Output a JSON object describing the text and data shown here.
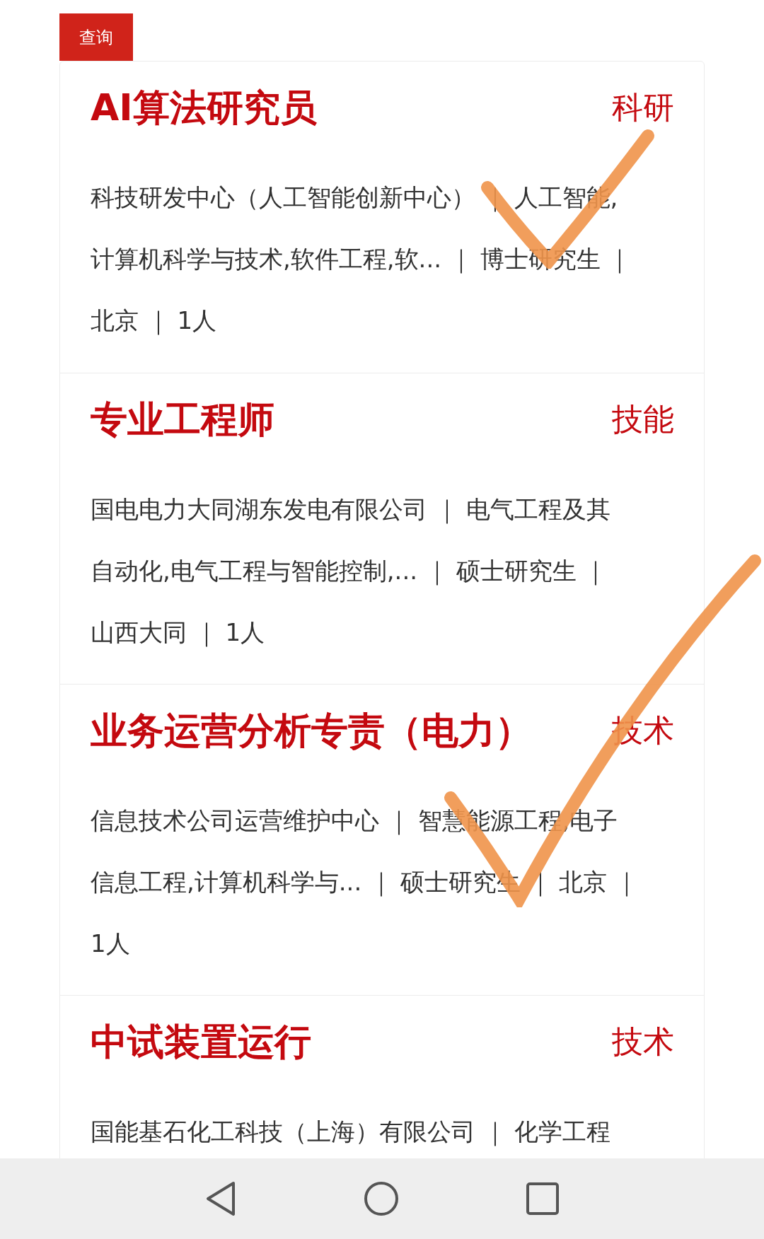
{
  "query_button": "查询",
  "jobs": [
    {
      "title": "AI算法研究员",
      "tag": "科研",
      "info_lines": [
        "科技研发中心（人工智能创新中心） ｜ 人工智能,",
        "计算机科学与技术,软件工程,软... ｜ 博士研究生 ｜",
        "北京 ｜ 1人"
      ]
    },
    {
      "title": "专业工程师",
      "tag": "技能",
      "info_lines": [
        "国电电力大同湖东发电有限公司 ｜ 电气工程及其",
        "自动化,电气工程与智能控制,... ｜ 硕士研究生 ｜",
        "山西大同 ｜ 1人"
      ]
    },
    {
      "title": "业务运营分析专责（电力）",
      "tag": "技术",
      "info_lines": [
        "信息技术公司运营维护中心 ｜ 智慧能源工程,电子",
        "信息工程,计算机科学与... ｜ 硕士研究生 ｜ 北京 ｜",
        "1人"
      ]
    },
    {
      "title": "中试装置运行",
      "tag": "技术",
      "info_lines": [
        "国能基石化工科技（上海）有限公司 ｜ 化学工程"
      ]
    }
  ]
}
